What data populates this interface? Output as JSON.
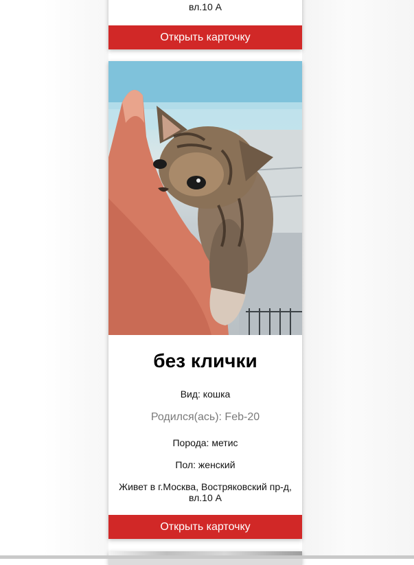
{
  "cards": {
    "previous": {
      "address_tail": "вл.10 А",
      "button": "Открыть карточку"
    },
    "current": {
      "name": "без клички",
      "species": "Вид: кошка",
      "born": "Родился(ась): Feb-20",
      "breed": "Порода: метис",
      "sex": "Пол: женский",
      "address_line1": "Живет в г.Москва, Востряковский пр-д,",
      "address_line2": "вл.10 А",
      "button": "Открыть карточку",
      "photo_icon": "kitten-photo"
    }
  },
  "colors": {
    "button_bg": "#d12827",
    "button_text": "#ffffff",
    "born_text": "#7a7a7a"
  }
}
